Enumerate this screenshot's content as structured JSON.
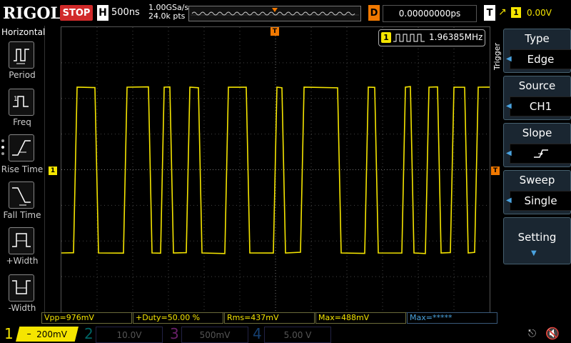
{
  "topbar": {
    "brand": "RIGOL",
    "run_state": "STOP",
    "horizontal_label": "H",
    "timebase": "500ns",
    "sample_rate": "1.00GSa/s",
    "mem_depth": "24.0k pts",
    "delay_label": "D",
    "delay_value": "0.00000000ps",
    "trigger_label": "T",
    "trigger_source": "1",
    "trigger_level": "0.00V"
  },
  "left_menu": {
    "header": "Horizontal",
    "items": [
      {
        "label": "Period",
        "icon": "period-icon"
      },
      {
        "label": "Freq",
        "icon": "freq-icon"
      },
      {
        "label": "Rise Time",
        "icon": "rise-time-icon"
      },
      {
        "label": "Fall Time",
        "icon": "fall-time-icon"
      },
      {
        "label": "+Width",
        "icon": "plus-width-icon"
      },
      {
        "label": "-Width",
        "icon": "minus-width-icon"
      }
    ]
  },
  "frequency_readout": {
    "channel": "1",
    "value": "1.96385MHz"
  },
  "trigger_menu": {
    "side_label": "Trigger",
    "type_title": "Type",
    "type_value": "Edge",
    "source_title": "Source",
    "source_value": "CH1",
    "slope_title": "Slope",
    "sweep_title": "Sweep",
    "sweep_value": "Single",
    "setting_title": "Setting"
  },
  "markers": {
    "channel_marker": "1",
    "trigger_marker": "T"
  },
  "measurements": {
    "vpp": "Vpp=976mV",
    "duty": "+Duty=50.00 %",
    "rms": "Rms=437mV",
    "max": "Max=488mV",
    "max2": "Max=*****"
  },
  "channels": [
    {
      "num": "1",
      "scale": "200mV",
      "color": "#f5e500",
      "active": true
    },
    {
      "num": "2",
      "scale": "10.0V",
      "color": "#00c8c8",
      "active": false
    },
    {
      "num": "3",
      "scale": "500mV",
      "color": "#d040d0",
      "active": false
    },
    {
      "num": "4",
      "scale": "5.00 V",
      "color": "#2a7fe0",
      "active": false
    }
  ],
  "colors": {
    "ch1": "#f5e500",
    "trigger": "#f07800",
    "stop": "#d12a2a",
    "menu_accent": "#4aa3e0"
  }
}
